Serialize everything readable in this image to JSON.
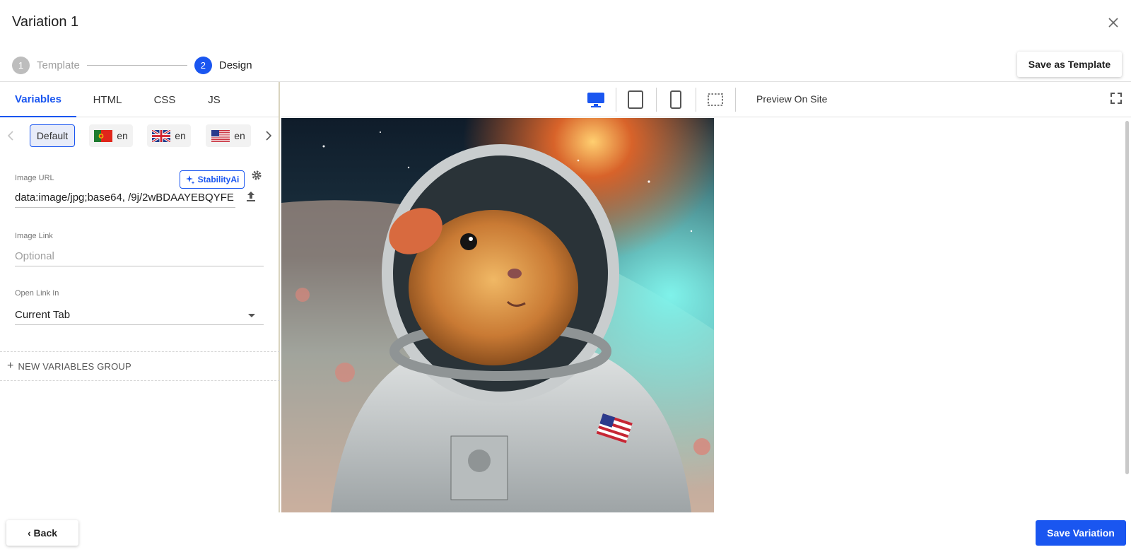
{
  "dialog": {
    "title": "Variation 1"
  },
  "stepper": {
    "steps": [
      {
        "number": "1",
        "label": "Template"
      },
      {
        "number": "2",
        "label": "Design"
      }
    ]
  },
  "header": {
    "save_template_label": "Save as Template"
  },
  "tabs": [
    "Variables",
    "HTML",
    "CSS",
    "JS"
  ],
  "languages": {
    "items": [
      {
        "label": "Default"
      },
      {
        "label": "en",
        "flag": "portugal-flag-icon"
      },
      {
        "label": "en",
        "flag": "uk-flag-icon"
      },
      {
        "label": "en",
        "flag": "us-flag-icon"
      }
    ]
  },
  "fields": {
    "image_url": {
      "label": "Image URL",
      "value": "data:image/jpg;base64, /9j/2wBDAAYEBQYFE"
    },
    "stability_label": "StabilityAi",
    "image_link": {
      "label": "Image Link",
      "placeholder": "Optional"
    },
    "open_link": {
      "label": "Open Link In",
      "value": "Current Tab"
    }
  },
  "new_group_label": "NEW VARIABLES GROUP",
  "toolbar": {
    "preview_label": "Preview On Site"
  },
  "footer": {
    "back_label": "Back",
    "save_label": "Save Variation"
  },
  "colors": {
    "accent": "#1a56f0",
    "muted": "#bdbdbd"
  }
}
